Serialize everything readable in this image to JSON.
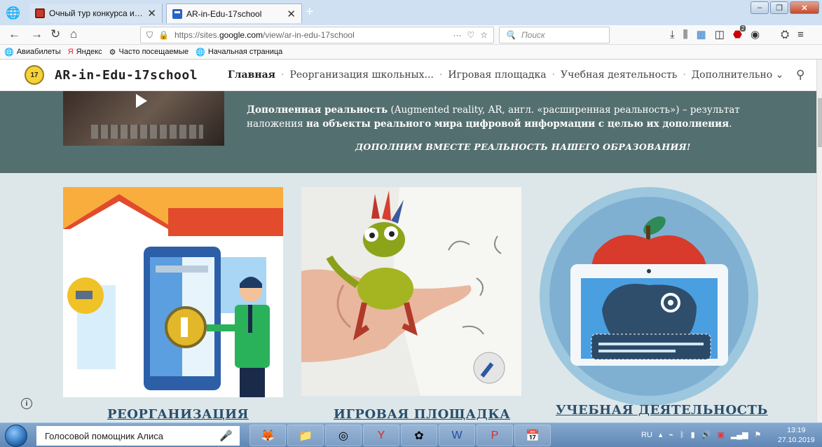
{
  "browser": {
    "tabs": [
      {
        "label": "Очный тур конкурса инновац",
        "active": false
      },
      {
        "label": "AR-in-Edu-17school",
        "active": true
      }
    ],
    "url_prefix": "https://sites.",
    "url_domain": "google.com",
    "url_path": "/view/ar-in-edu-17school",
    "search_placeholder": "Поиск",
    "adblock_badge": "2",
    "bookmarks": [
      "Авиабилеты",
      "Яндекс",
      "Часто посещаемые",
      "Начальная страница"
    ]
  },
  "site": {
    "logo_text": "17",
    "title": "AR-in-Edu-17school",
    "nav": [
      "Главная",
      "Реорганизация школьных...",
      "Игровая площадка",
      "Учебная деятельность",
      "Дополнительно"
    ],
    "banner": {
      "p1_bold": "Дополненная реальность",
      "p1_rest": " (Augmented reality, AR, англ. «расширенная реальность») – результат",
      "p2_start": "наложения ",
      "p2_bold": "на объекты реального мира цифровой информации с целью их дополнения",
      "p2_end": ".",
      "slogan": "ДОПОЛНИМ ВМЕСТЕ РЕАЛЬНОСТЬ НАШЕГО ОБРАЗОВАНИЯ!"
    },
    "cards": [
      {
        "title": "РЕОРГАНИЗАЦИЯ"
      },
      {
        "title": "ИГРОВАЯ ПЛОЩАДКА"
      },
      {
        "title": "УЧЕБНАЯ ДЕЯТЕЛЬНОСТЬ"
      }
    ],
    "info_icon": "i"
  },
  "taskbar": {
    "voice_assistant": "Голосовой помощник Алиса",
    "lang": "RU",
    "time": "13:19",
    "date": "27.10.2019"
  },
  "colors": {
    "banner_bg": "#546f70",
    "cards_bg": "#dde7ea",
    "card_title": "#2b4f6b"
  }
}
